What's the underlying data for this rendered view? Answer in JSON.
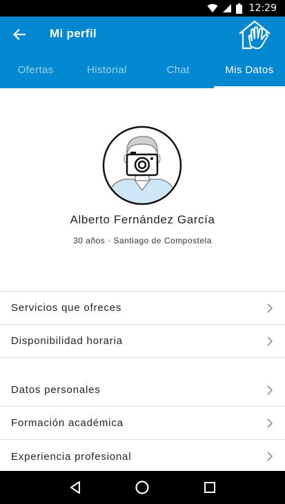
{
  "status_bar": {
    "time": "12:29",
    "icons": [
      "wifi-icon",
      "signal-icon",
      "battery-icon"
    ]
  },
  "header": {
    "back_icon": "arrow-left-icon",
    "title": "Mi perfil",
    "logo_icon": "house-hand-logo",
    "background_color": "#0288d1"
  },
  "tabs": [
    {
      "label": "Ofertas",
      "active": false
    },
    {
      "label": "Historial",
      "active": false
    },
    {
      "label": "Chat",
      "active": false
    },
    {
      "label": "Mis Datos",
      "active": true
    }
  ],
  "profile": {
    "avatar_icon": "avatar-camera-icon",
    "name": "Alberto Fernández García",
    "subtitle": "30 años · Santiago de Compostela"
  },
  "list_section_1": [
    {
      "label": "Servicios que ofreces"
    },
    {
      "label": "Disponibilidad horaria"
    }
  ],
  "list_section_2": [
    {
      "label": "Datos personales"
    },
    {
      "label": "Formación académica"
    },
    {
      "label": "Experiencia profesional"
    }
  ],
  "nav_bar": {
    "icons": [
      "back-triangle-icon",
      "home-circle-icon",
      "recents-square-icon"
    ]
  }
}
